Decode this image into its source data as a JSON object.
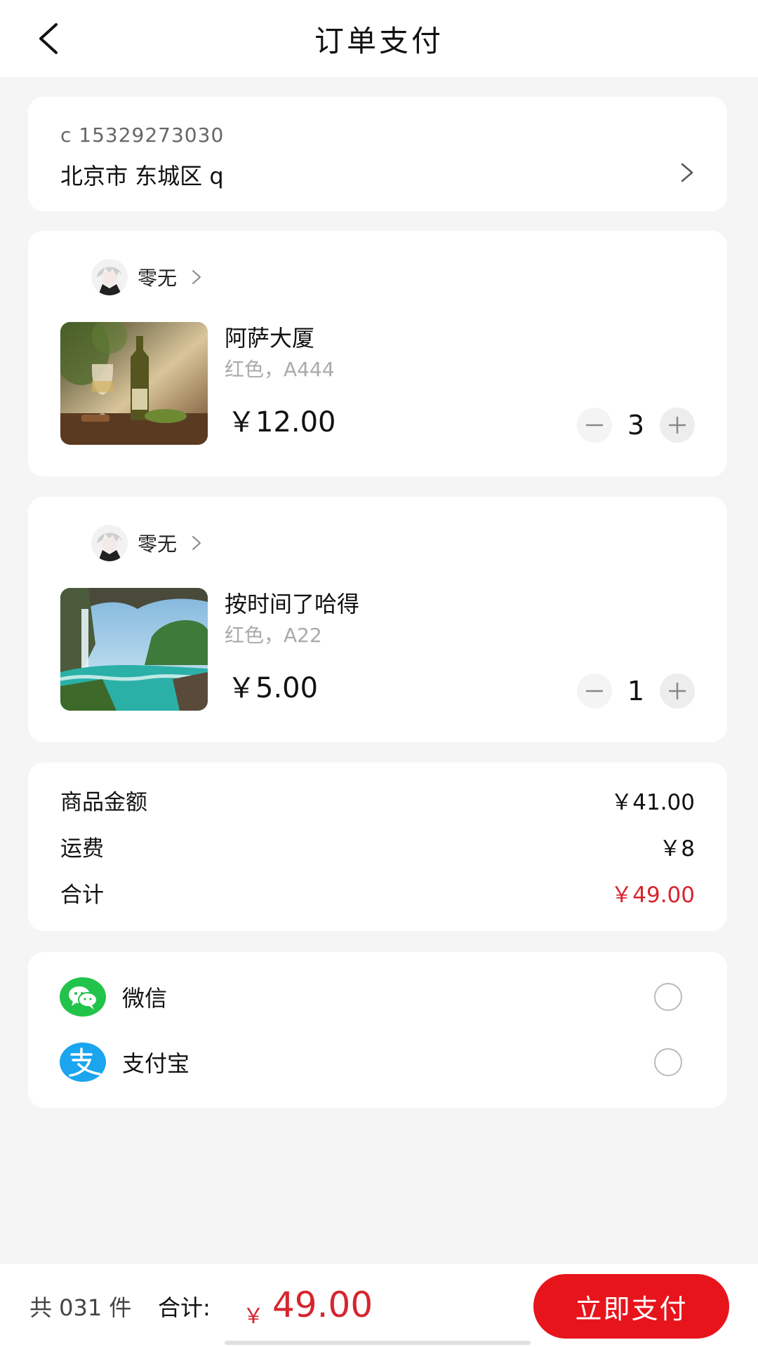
{
  "header": {
    "title": "订单支付"
  },
  "address": {
    "phone": "c  15329273030",
    "text": "北京市 东城区 q"
  },
  "items": [
    {
      "seller": "零无",
      "title": "阿萨大厦",
      "spec": "红色，A444",
      "price": "￥12.00",
      "quantity": "3",
      "thumb_icon": "wine-bottle-glass-photo"
    },
    {
      "seller": "零无",
      "title": "按时间了哈得",
      "spec": "红色，A22",
      "price": "￥5.00",
      "quantity": "1",
      "thumb_icon": "waterfall-landscape-photo"
    }
  ],
  "summary": {
    "goods_label": "商品金额",
    "goods_value": "￥41.00",
    "shipping_label": "运费",
    "shipping_value": "￥8",
    "total_label": "合计",
    "total_value": "￥49.00"
  },
  "payment": {
    "wechat_label": "微信",
    "alipay_label": "支付宝"
  },
  "footer": {
    "count": "共 031 件",
    "total_label": "合计:",
    "currency": "￥",
    "amount": "49.00",
    "pay_button": "立即支付"
  },
  "colors": {
    "accent": "#e8141c",
    "price_red": "#d6252e",
    "wechat": "#22c34a",
    "alipay": "#1aa5ee"
  }
}
